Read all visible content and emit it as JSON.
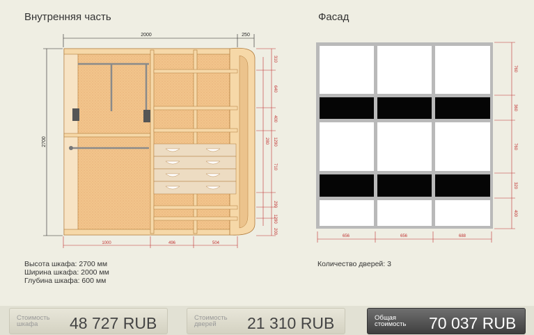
{
  "interior": {
    "title": "Внутренняя часть",
    "width_label": "2000",
    "side_label": "250",
    "height_label": "2700",
    "bottom_dims": [
      "1000",
      "496",
      "504"
    ],
    "right_dims": [
      "310",
      "640",
      "400",
      "1290",
      "710",
      "290",
      "1290",
      "200"
    ],
    "right_small": "280"
  },
  "facade": {
    "title": "Фасад",
    "bottom_dims": [
      "656",
      "656",
      "688"
    ],
    "right_dims": [
      "760",
      "360",
      "760",
      "320",
      "400"
    ]
  },
  "specs": {
    "height": "Высота шкафа: 2700 мм",
    "width": "Ширина шкафа: 2000 мм",
    "depth": "Глубина шкафа: 600 мм"
  },
  "doors_count": "Количество дверей: 3",
  "prices": {
    "cabinet": {
      "label": "Стоимость шкафа",
      "value": "48 727  RUB"
    },
    "doors": {
      "label": "Стоимость дверей",
      "value": "21 310  RUB"
    },
    "total": {
      "label": "Общая стоимость",
      "value": "70 037  RUB"
    }
  },
  "colors": {
    "wood": "#f3c58c",
    "frame": "#b9b9b9",
    "glass_dark": "#050505",
    "dim_red": "#c03030"
  }
}
